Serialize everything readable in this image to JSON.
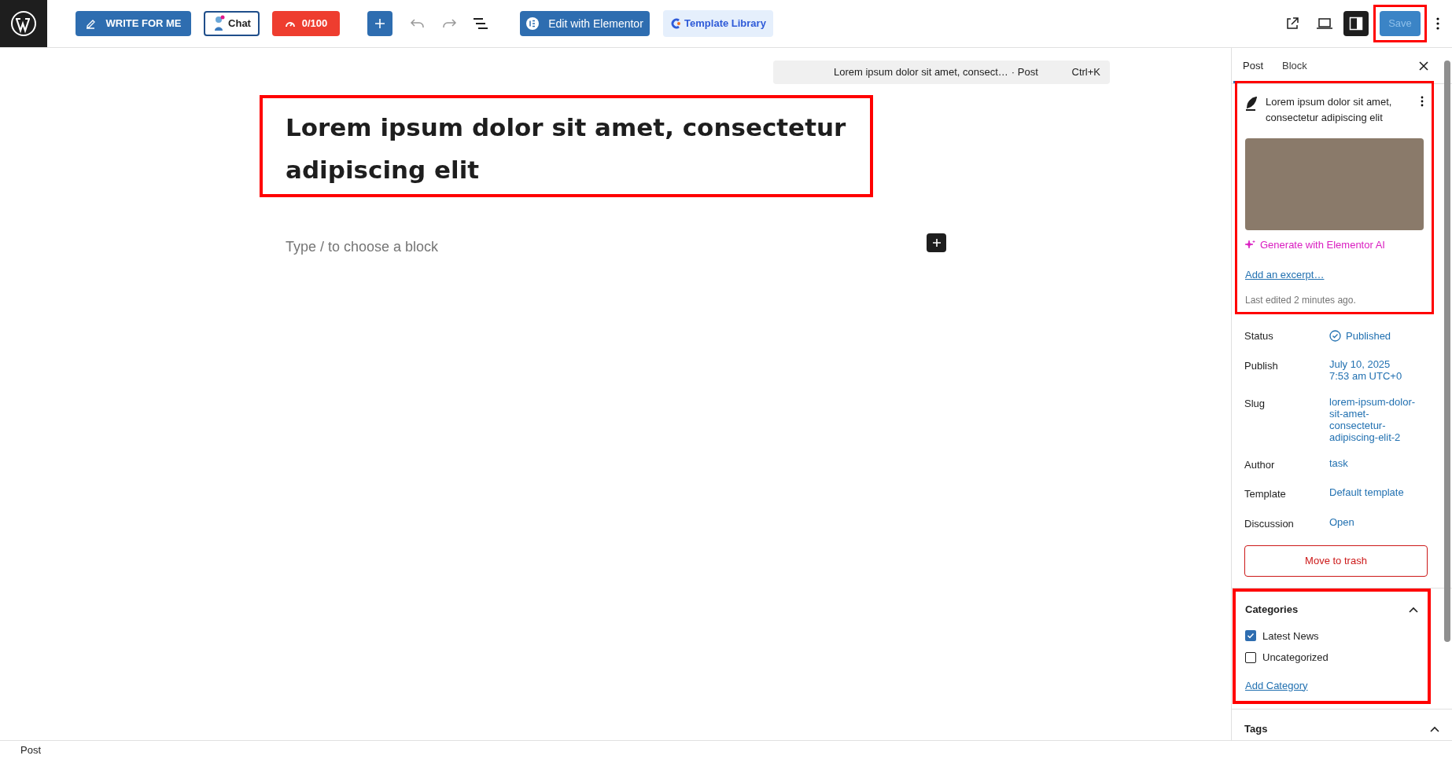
{
  "toolbar": {
    "write_button": "WRITE FOR ME",
    "chat_button": "Chat",
    "score_button": "0/100",
    "elementor_button": "Edit with Elementor",
    "template_button": "Template Library",
    "save_button": {
      "label": "Save",
      "disabled": true
    }
  },
  "command_bar": {
    "title": "Lorem ipsum dolor sit amet, consect…",
    "type": "· Post",
    "shortcut": "Ctrl+K"
  },
  "editor": {
    "title": "Lorem ipsum dolor sit amet, consectetur adipiscing elit",
    "placeholder": "Type / to choose a block"
  },
  "sidebar": {
    "tabs": [
      {
        "label": "Post",
        "selected": true
      },
      {
        "label": "Block",
        "selected": false
      }
    ],
    "post_title": "Lorem ipsum dolor sit amet, consectetur adipiscing elit",
    "ai_link": "Generate with Elementor AI",
    "excerpt_link": "Add an excerpt…",
    "last_edited": "Last edited 2 minutes ago.",
    "fields": [
      {
        "kind": "status",
        "label": "Status",
        "value": "Published"
      },
      {
        "kind": "text",
        "label": "Publish",
        "value": "July 10, 2025\n7:53 am UTC+0"
      },
      {
        "kind": "text",
        "label": "Slug",
        "value": "lorem-ipsum-dolor-sit-amet-consectetur-adipiscing-elit-2"
      },
      {
        "kind": "text",
        "label": "Author",
        "value": "task"
      },
      {
        "kind": "text",
        "label": "Template",
        "value": "Default template"
      },
      {
        "kind": "text",
        "label": "Discussion",
        "value": "Open"
      }
    ],
    "trash_button": "Move to trash",
    "categories": {
      "title": "Categories",
      "expanded": true,
      "items": [
        {
          "label": "Latest News",
          "checked": true
        },
        {
          "label": "Uncategorized",
          "checked": false
        }
      ],
      "add_link": "Add Category"
    },
    "tags": {
      "title": "Tags",
      "expanded": true
    }
  },
  "status_bar": "Post"
}
